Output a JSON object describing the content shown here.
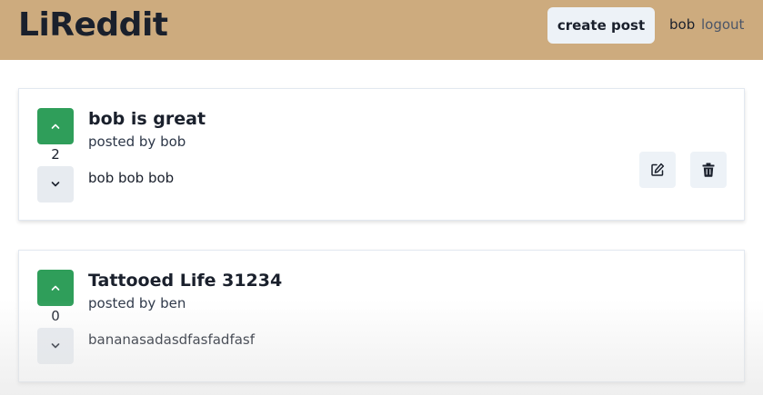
{
  "app": {
    "title": "LiReddit"
  },
  "nav": {
    "create_post_label": "create post",
    "username": "bob",
    "logout_label": "logout"
  },
  "icons": {
    "upvote": "chevron-up-icon",
    "downvote": "chevron-down-icon",
    "edit": "edit-icon",
    "delete": "trash-icon"
  },
  "colors": {
    "navbar": "#cdab7e",
    "upvote_active": "#2f9e5a",
    "button_gray": "#edf2f7"
  },
  "posts": [
    {
      "title": "bob is great",
      "author_line": "posted by bob",
      "text": "bob bob bob",
      "points": "2"
    },
    {
      "title": "Tattooed Life 31234",
      "author_line": "posted by ben",
      "text": "bananasadasdfasfadfasf",
      "points": "0"
    }
  ]
}
